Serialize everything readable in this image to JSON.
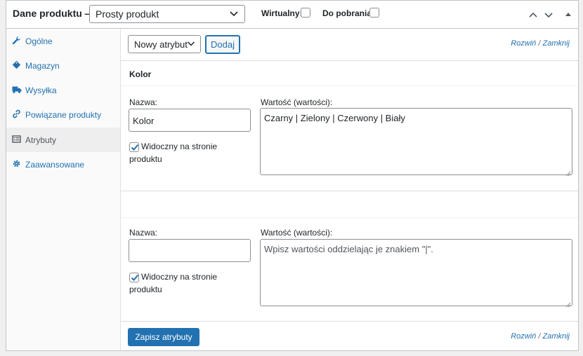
{
  "header": {
    "title": "Dane produktu —",
    "product_type": "Prosty produkt",
    "virtual_label": "Wirtualny:",
    "download_label": "Do pobrania:"
  },
  "sidebar": {
    "items": [
      {
        "label": "Ogólne",
        "icon": "wrench-icon"
      },
      {
        "label": "Magazyn",
        "icon": "tag-icon"
      },
      {
        "label": "Wysyłka",
        "icon": "truck-icon"
      },
      {
        "label": "Powiązane produkty",
        "icon": "link-icon"
      },
      {
        "label": "Atrybuty",
        "icon": "list-icon",
        "active": true
      },
      {
        "label": "Zaawansowane",
        "icon": "gear-icon"
      }
    ]
  },
  "toolbar": {
    "attribute_select": "Nowy atrybut",
    "add_label": "Dodaj",
    "expand": "Rozwiń",
    "separator": "/",
    "close": "Zamknij"
  },
  "attributes": [
    {
      "title": "Kolor",
      "name_label": "Nazwa:",
      "name_value": "Kolor",
      "values_label": "Wartość (wartości):",
      "values_value": "Czarny | Zielony | Czerwony | Biały",
      "visible_label": "Widoczny na stronie produktu",
      "visible_checked": true
    },
    {
      "title": "",
      "name_label": "Nazwa:",
      "name_value": "",
      "values_label": "Wartość (wartości):",
      "values_placeholder": "Wpisz wartości oddzielając je znakiem \"|\".",
      "visible_label": "Widoczny na stronie produktu",
      "visible_checked": true
    }
  ],
  "footer": {
    "save_label": "Zapisz atrybuty",
    "expand": "Rozwiń",
    "separator": "/",
    "close": "Zamknij"
  },
  "colors": {
    "accent": "#2271b1",
    "border": "#c3c4c7",
    "text": "#1d2327"
  }
}
